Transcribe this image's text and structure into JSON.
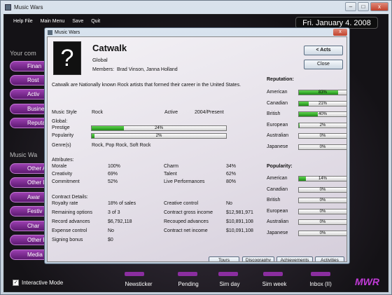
{
  "window": {
    "title": "Music Wars",
    "min": "–",
    "max": "□",
    "close": "x"
  },
  "menu": [
    "Help File",
    "Main Menu",
    "Save",
    "Quit"
  ],
  "date": "Fri. January 4. 2008",
  "left": {
    "section1": "Your com",
    "btns1": [
      "Finan",
      "Rost",
      "Activ",
      "Busine",
      "Reputa"
    ],
    "section2": "Music Wa",
    "btns2": [
      "Other A",
      "Other L",
      "Awar",
      "Festiv",
      "Char",
      "Other Bu",
      "Media O"
    ]
  },
  "bottom": {
    "interactive": "Interactive Mode",
    "check": "✓",
    "buttons": [
      "Newsticker",
      "Pending",
      "Sim day",
      "Sim week",
      "Inbox (II)"
    ],
    "logo": "MWR"
  },
  "dialog": {
    "title": "Music Wars",
    "close": "x",
    "avatar": "?",
    "name": "Catwalk",
    "scope": "Global",
    "members_label": "Members:",
    "members": "Brad Vinson, Janna Holland",
    "description": "Catwalk are Nationally known Rock artists that formed their career in the United States.",
    "style_label": "Music Style",
    "style": "Rock",
    "active_label": "Active",
    "active": "2004/Present",
    "global_label": "Global:",
    "prestige_label": "Prestige",
    "prestige": 24,
    "prestige_text": "24%",
    "popularity_label": "Popularity",
    "popularity": 2,
    "popularity_text": "2%",
    "genres_label": "Genre(s)",
    "genres": "Rock, Pop Rock, Soft Rock",
    "attributes_label": "Attributes:",
    "attributes": [
      [
        "Morale",
        "100%",
        "Charm",
        "34%"
      ],
      [
        "Creativity",
        "69%",
        "Talent",
        "62%"
      ],
      [
        "Commitment",
        "52%",
        "Live Performances",
        "80%"
      ]
    ],
    "contract_label": "Contract Details:",
    "contract": [
      [
        "Royalty rate",
        "18% of sales",
        "Creative control",
        "No"
      ],
      [
        "Remaining options",
        "3 of 3",
        "Contract gross income",
        "$12,981,971"
      ],
      [
        "Record advances",
        "$6,792,118",
        "Recouped advances",
        "$10,891,108"
      ],
      [
        "Expense control",
        "No",
        "Contract net income",
        "$10,091,108"
      ],
      [
        "Signing bonus",
        "$0",
        "",
        ""
      ]
    ],
    "acts_btn": "< Acts",
    "close_btn": "Close",
    "reputation_label": "Reputation:",
    "reputation": [
      {
        "c": "American",
        "v": 83,
        "t": "83%"
      },
      {
        "c": "Canadian",
        "v": 21,
        "t": "21%"
      },
      {
        "c": "British",
        "v": 40,
        "t": "40%"
      },
      {
        "c": "European",
        "v": 2,
        "t": "2%"
      },
      {
        "c": "Australian",
        "v": 0,
        "t": "0%"
      },
      {
        "c": "Japanese",
        "v": 0,
        "t": "0%"
      }
    ],
    "popularity_section": "Popularity:",
    "pop": [
      {
        "c": "American",
        "v": 14,
        "t": "14%"
      },
      {
        "c": "Canadian",
        "v": 0,
        "t": "0%"
      },
      {
        "c": "British",
        "v": 0,
        "t": "0%"
      },
      {
        "c": "European",
        "v": 0,
        "t": "0%"
      },
      {
        "c": "Australian",
        "v": 0,
        "t": "0%"
      },
      {
        "c": "Japanese",
        "v": 0,
        "t": "0%"
      }
    ],
    "footer_btns": [
      "Tours",
      "Discography",
      "Achievements",
      "Activities"
    ]
  }
}
